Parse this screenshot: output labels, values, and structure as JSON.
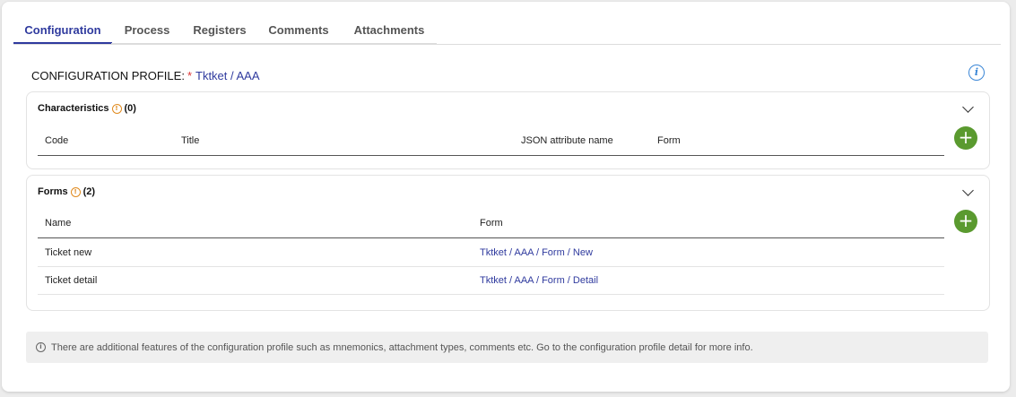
{
  "tabs": [
    {
      "label": "Configuration",
      "active": true
    },
    {
      "label": "Process",
      "active": false
    },
    {
      "label": "Registers",
      "active": false
    },
    {
      "label": "Comments",
      "active": false
    },
    {
      "label": "Attachments",
      "active": false
    }
  ],
  "profile": {
    "label": "CONFIGURATION PROFILE:",
    "required_mark": "*",
    "value": "Tktket / AAA"
  },
  "characteristics": {
    "title": "Characteristics",
    "count": "(0)",
    "columns": [
      "Code",
      "Title",
      "JSON attribute name",
      "Form"
    ]
  },
  "forms": {
    "title": "Forms",
    "count": "(2)",
    "columns": [
      "Name",
      "Form"
    ],
    "rows": [
      {
        "name": "Ticket new",
        "form": "Tktket / AAA / Form / New"
      },
      {
        "name": "Ticket detail",
        "form": "Tktket / AAA / Form / Detail"
      }
    ]
  },
  "note": {
    "text": "There are additional features of the configuration profile such as mnemonics, attachment types, comments etc. Go to the configuration profile detail for more info."
  },
  "icons": {
    "info": "info-icon",
    "warning": "warning-icon",
    "chevron": "chevron-down-icon",
    "add": "plus-icon"
  },
  "colors": {
    "accent": "#2f3a9e",
    "add_button": "#5a9a2f",
    "warning": "#e08a1e",
    "info": "#3a86d6"
  }
}
